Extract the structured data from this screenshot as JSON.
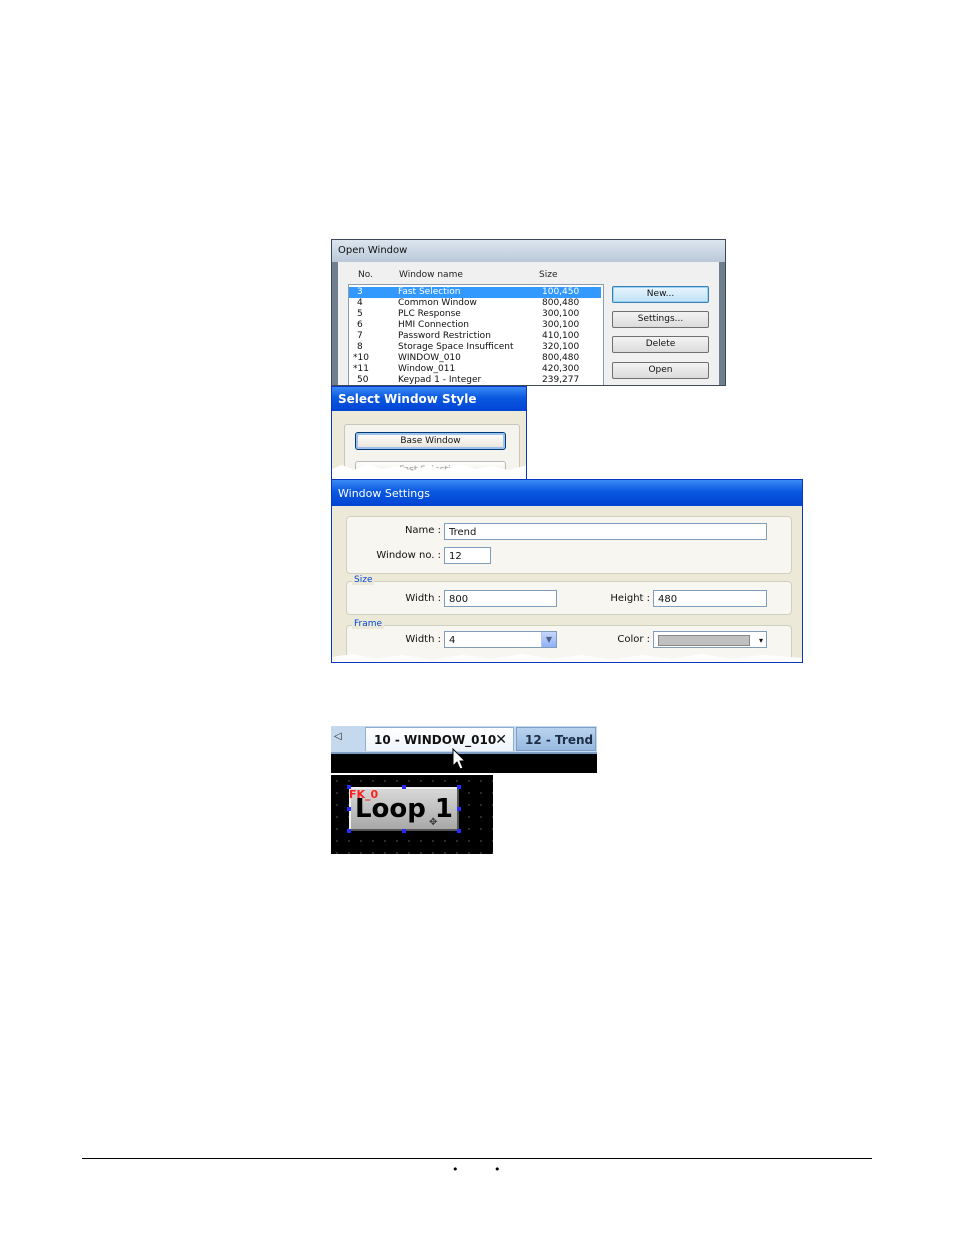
{
  "open_window": {
    "title": "Open Window",
    "columns": {
      "no": "No.",
      "name": "Window name",
      "size": "Size"
    },
    "rows": [
      {
        "no": "3",
        "name": "Fast Selection",
        "size": "100,450",
        "selected": true
      },
      {
        "no": "4",
        "name": "Common Window",
        "size": "800,480"
      },
      {
        "no": "5",
        "name": "PLC Response",
        "size": "300,100"
      },
      {
        "no": "6",
        "name": "HMI Connection",
        "size": "300,100"
      },
      {
        "no": "7",
        "name": "Password Restriction",
        "size": "410,100"
      },
      {
        "no": "8",
        "name": "Storage Space Insufficent",
        "size": "320,100"
      },
      {
        "no": "*10",
        "name": "WINDOW_010",
        "size": "800,480"
      },
      {
        "no": "*11",
        "name": "Window_011",
        "size": "420,300"
      },
      {
        "no": "50",
        "name": "Keypad 1 - Integer",
        "size": "239,277"
      }
    ],
    "buttons": {
      "new": "New...",
      "settings": "Settings...",
      "delete": "Delete",
      "open": "Open"
    }
  },
  "select_style": {
    "title": "Select Window Style",
    "base_button": "Base Window",
    "fast_button": "Fast Selection"
  },
  "window_settings": {
    "title": "Window Settings",
    "name_label": "Name :",
    "name_value": "Trend",
    "no_label": "Window no. :",
    "no_value": "12",
    "size_group": "Size",
    "width_label": "Width :",
    "width_value": "800",
    "height_label": "Height :",
    "height_value": "480",
    "frame_group": "Frame",
    "frame_width_label": "Width :",
    "frame_width_value": "4",
    "color_label": "Color :",
    "color_value": "#c0c0c0"
  },
  "tabs": {
    "active": "10 - WINDOW_010",
    "inactive": "12 - Trend",
    "close_glyph": "✕",
    "scroll_glyph": "◁"
  },
  "canvas": {
    "object_id": "FK_0",
    "button_text": "Loop 1"
  },
  "footer": {
    "bullet": "•"
  }
}
